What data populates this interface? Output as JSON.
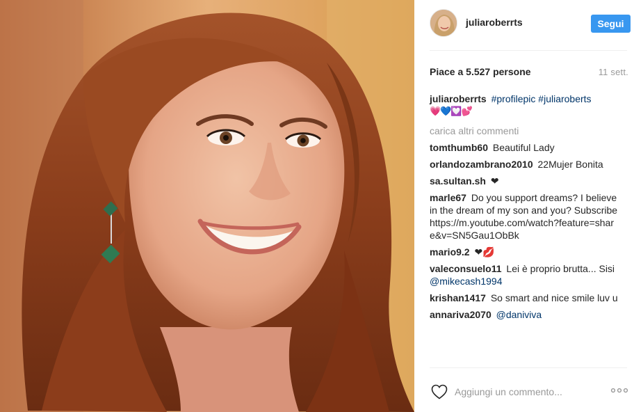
{
  "header": {
    "username": "juliaroberrts",
    "follow_label": "Segui"
  },
  "post": {
    "likes_text": "Piace a 5.527 persone",
    "time_text": "11 sett."
  },
  "caption": {
    "user": "juliaroberrts",
    "hashtags": "#profilepic #juliaroberts",
    "emojis": "💗💙💟💕"
  },
  "load_more": "carica altri commenti",
  "comments": [
    {
      "user": "tomthumb60",
      "text": "Beautiful Lady"
    },
    {
      "user": "orlandozambrano2010",
      "text": "22Mujer Bonita"
    },
    {
      "user": "sa.sultan.sh",
      "text": "❤"
    },
    {
      "user": "marle67",
      "text": "Do you support dreams? I believe in the dream of my son and you? Subscribehttps://m.youtube.com/watch?feature=share&v=SN5Gau1ObBk"
    },
    {
      "user": "mario9.2",
      "text": "❤",
      "extra": "💋"
    },
    {
      "user": "valeconsuelo11",
      "text": "Lei è proprio brutta... Sisi",
      "mention": "@mikecash1994"
    },
    {
      "user": "krishan1417",
      "text": "So smart and nice smile luv u"
    },
    {
      "user": "annariva2070",
      "text": "",
      "mention": "@daniviva"
    }
  ],
  "composer": {
    "placeholder": "Aggiungi un commento..."
  },
  "icons": {
    "like": "heart-outline-icon",
    "more": "more-dots-icon"
  },
  "colors": {
    "accent": "#3897f0",
    "link": "#003569",
    "muted": "#999999"
  }
}
